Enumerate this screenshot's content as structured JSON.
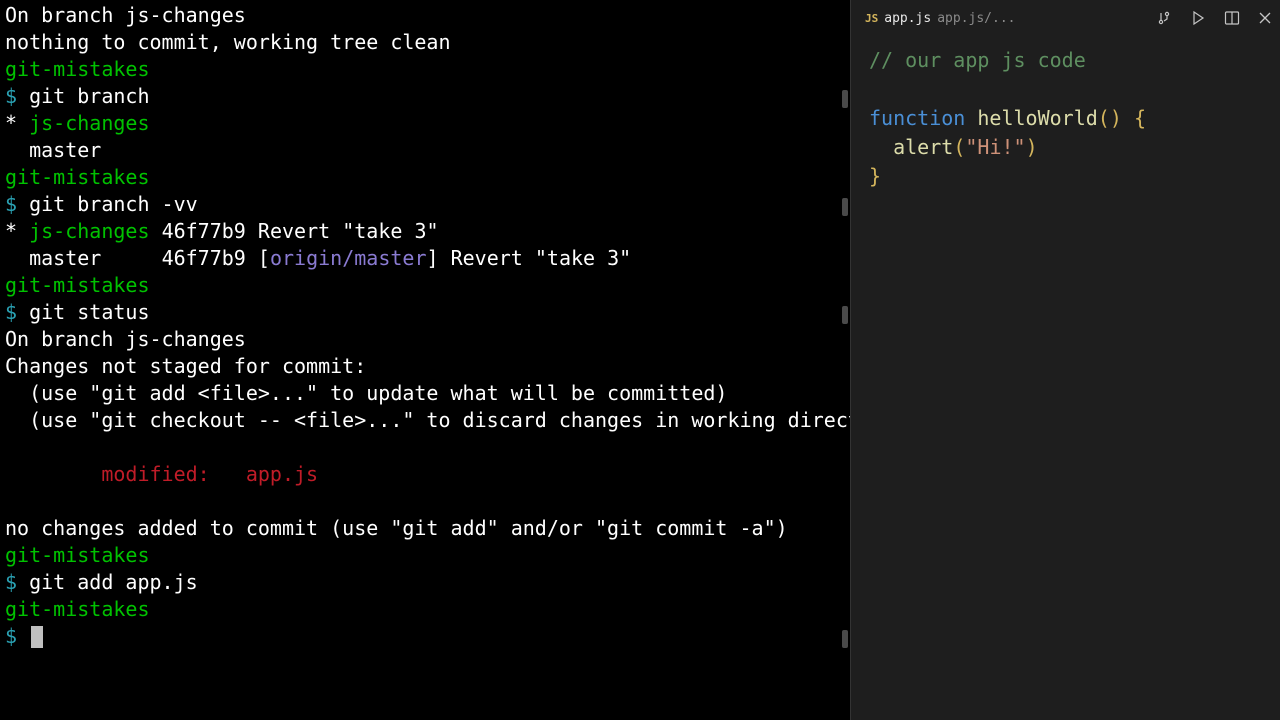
{
  "terminal": {
    "seg_on_branch": "On branch js-changes",
    "seg_nothing": "nothing to commit, working tree clean",
    "cwd": "git-mistakes",
    "prompt_symbol": "$",
    "cmd_branch": "git branch",
    "branch_star": "*",
    "branch_current": "js-changes",
    "branch_other": "master",
    "cmd_branch_vv": "git branch -vv",
    "vv_current_hash": "46f77b9",
    "vv_current_msg": "Revert \"take 3\"",
    "vv_master": "master",
    "vv_master_hash": "46f77b9",
    "vv_upstream_l": "[",
    "vv_upstream": "origin/master",
    "vv_upstream_r": "]",
    "vv_master_msg": "Revert \"take 3\"",
    "cmd_status": "git status",
    "status_on_branch": "On branch js-changes",
    "status_not_staged": "Changes not staged for commit:",
    "status_hint1": "  (use \"git add <file>...\" to update what will be committed)",
    "status_hint2": "  (use \"git checkout -- <file>...\" to discard changes in working directory)",
    "status_modified_label": "modified:   ",
    "status_modified_file": "app.js",
    "status_no_changes": "no changes added to commit (use \"git add\" and/or \"git commit -a\")",
    "cmd_add": "git add app.js"
  },
  "editor": {
    "tab": {
      "lang": "JS",
      "filename": "app.js",
      "path": "app.js/..."
    },
    "code": {
      "l1_comment": "// our app js code",
      "l2_kw": "function",
      "l2_name": "helloWorld",
      "l2_paren": "()",
      "l2_brace_open": "{",
      "l3_indent": "  ",
      "l3_fn": "alert",
      "l3_po": "(",
      "l3_str": "\"Hi!\"",
      "l3_pc": ")",
      "l4_brace_close": "}"
    }
  }
}
